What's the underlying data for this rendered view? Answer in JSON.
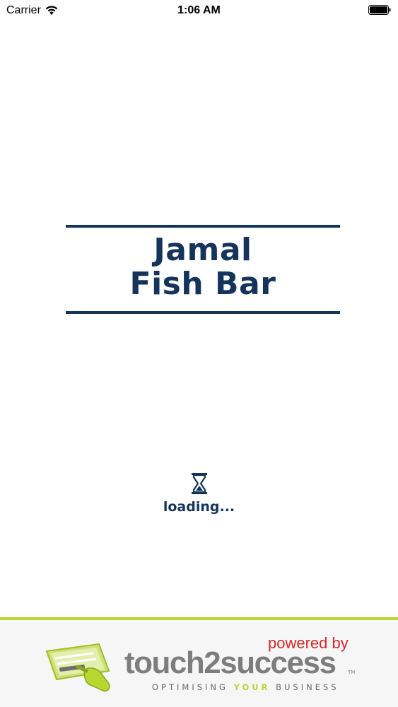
{
  "status_bar": {
    "carrier": "Carrier",
    "time": "1:06 AM",
    "icons": [
      "wifi-icon",
      "battery-icon"
    ]
  },
  "restaurant": {
    "name_line1": "Jamal",
    "name_line2": "Fish Bar",
    "brand_color": "#14345c"
  },
  "loading": {
    "icon": "hourglass-icon",
    "text": "loading..."
  },
  "footer": {
    "powered_by": "powered by",
    "brand_name": "touch2success",
    "trademark": "TM",
    "tagline_part1": "OPTIMISING ",
    "tagline_highlight": "YOUR",
    "tagline_part2": " BUSINESS",
    "accent_color": "#b9d631",
    "powered_color": "#d9262a"
  }
}
